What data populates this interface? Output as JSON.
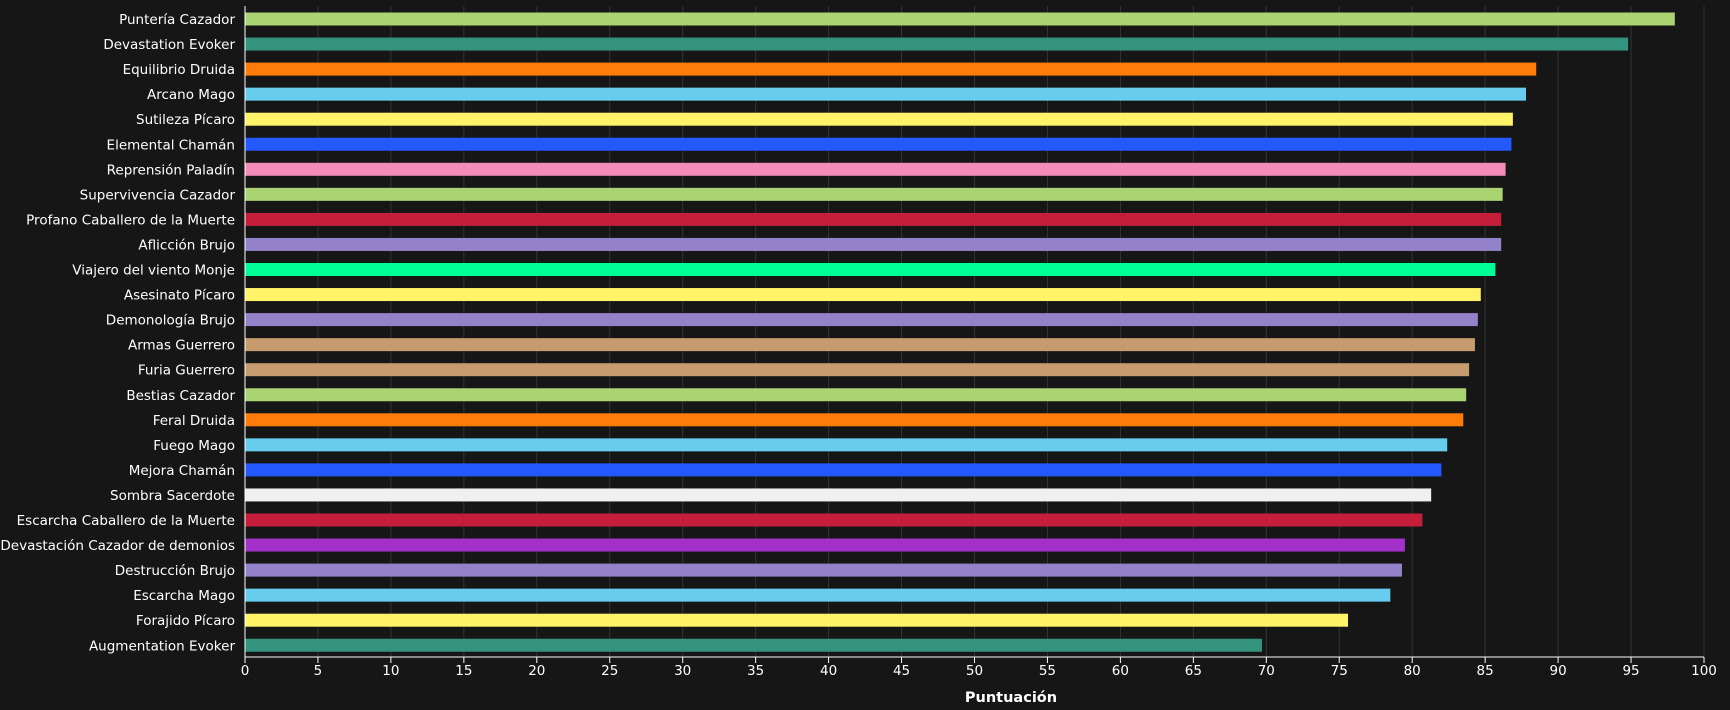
{
  "chart_data": {
    "type": "bar",
    "orientation": "horizontal",
    "xlabel": "Puntuación",
    "ylabel": "",
    "xlim": [
      0,
      100
    ],
    "xticks": [
      0,
      5,
      10,
      15,
      20,
      25,
      30,
      35,
      40,
      45,
      50,
      55,
      60,
      65,
      70,
      75,
      80,
      85,
      90,
      95,
      100
    ],
    "grid": true,
    "legend": "none",
    "background": "#161616",
    "text_color": "#ffffff",
    "grid_color": "#333333",
    "categories": [
      "Puntería Cazador",
      "Devastation Evoker",
      "Equilibrio Druida",
      "Arcano Mago",
      "Sutileza Pícaro",
      "Elemental Chamán",
      "Reprensión Paladín",
      "Supervivencia Cazador",
      "Profano Caballero de la Muerte",
      "Aflicción Brujo",
      "Viajero del viento Monje",
      "Asesinato Pícaro",
      "Demonología Brujo",
      "Armas Guerrero",
      "Furia Guerrero",
      "Bestias Cazador",
      "Feral Druida",
      "Fuego Mago",
      "Mejora Chamán",
      "Sombra Sacerdote",
      "Escarcha Caballero de la Muerte",
      "Devastación Cazador de demonios",
      "Destrucción Brujo",
      "Escarcha Mago",
      "Forajido Pícaro",
      "Augmentation Evoker"
    ],
    "values": [
      98.0,
      94.8,
      88.5,
      87.8,
      86.9,
      86.8,
      86.4,
      86.2,
      86.1,
      86.1,
      85.7,
      84.7,
      84.5,
      84.3,
      83.9,
      83.7,
      83.5,
      82.4,
      82.0,
      81.3,
      80.7,
      79.5,
      79.3,
      78.5,
      75.6,
      69.7
    ],
    "colors": [
      "#aad372",
      "#33937f",
      "#ff7c0a",
      "#68ccef",
      "#fff468",
      "#2359ff",
      "#f48cba",
      "#aad372",
      "#c41e3b",
      "#9382c9",
      "#00ff96",
      "#fff468",
      "#9382c9",
      "#c69b6d",
      "#c69b6d",
      "#aad372",
      "#ff7c0a",
      "#68ccef",
      "#2359ff",
      "#f0f0f0",
      "#c41e3b",
      "#a330c9",
      "#9382c9",
      "#68ccef",
      "#fff468",
      "#33937f"
    ]
  }
}
